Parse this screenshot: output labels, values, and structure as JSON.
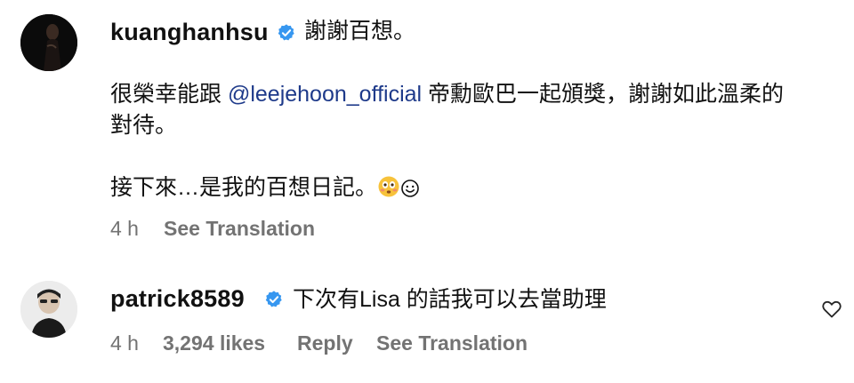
{
  "comments": [
    {
      "username": "kuanghanhsu",
      "verified": true,
      "first_line": "謝謝百想。",
      "body_prefix": "很榮幸能跟 ",
      "mention": "@leejehoon_official",
      "body_suffix": " 帝勳歐巴一起頒獎，謝謝如此溫柔的",
      "body_line2": "對待。",
      "body_line3": "接下來…是我的百想日記。",
      "emojis": [
        "flushed-face-icon",
        "smiling-face-icon"
      ],
      "time": "4 h",
      "see_translation": "See Translation"
    },
    {
      "username": "patrick8589",
      "verified": true,
      "text": "下次有Lisa 的話我可以去當助理",
      "time": "4 h",
      "likes": "3,294 likes",
      "reply": "Reply",
      "see_translation": "See Translation"
    }
  ],
  "colors": {
    "verified_blue": "#3797f0",
    "mention": "#1e3a8a",
    "meta_gray": "#737373"
  }
}
